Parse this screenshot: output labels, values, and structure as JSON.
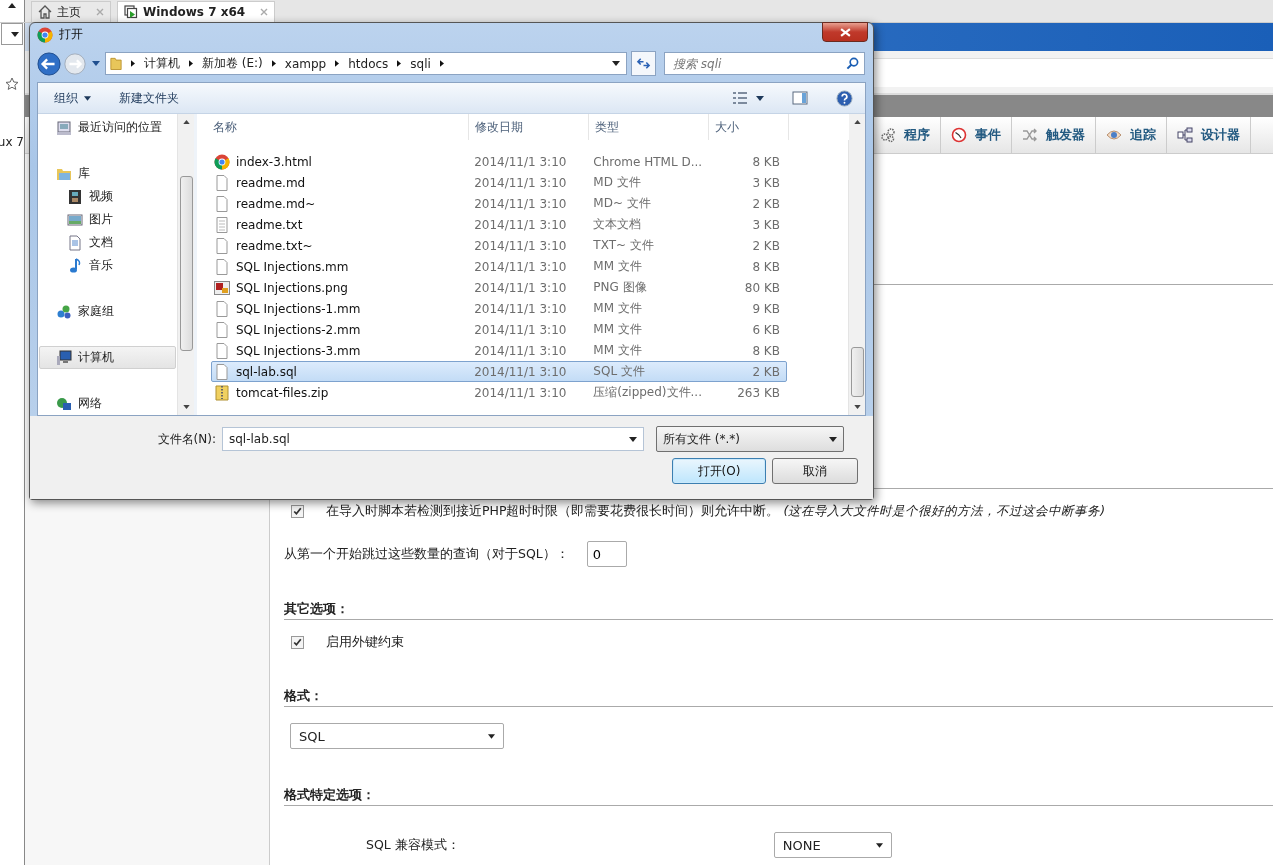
{
  "browser_tabs": [
    {
      "label": "主页",
      "selected": false
    },
    {
      "label": "Windows 7 x64",
      "selected": true
    }
  ],
  "side_strip": {
    "partial_text": "ux 7"
  },
  "page": {
    "nav_tabs": [
      {
        "label": "程序"
      },
      {
        "label": "事件"
      },
      {
        "label": "触发器"
      },
      {
        "label": "追踪"
      },
      {
        "label": "设计器"
      }
    ],
    "interrupt": {
      "checked": true,
      "text": "在导入时脚本若检测到接近PHP超时时限（即需要花费很长时间）则允许中断。",
      "note": "(这在导入大文件时是个很好的方法，不过这会中断事务)"
    },
    "skip": {
      "label": "从第一个开始跳过这些数量的查询（对于SQL）：",
      "value": "0"
    },
    "other_options": {
      "heading": "其它选项：",
      "foreign_keys": {
        "checked": true,
        "label": "启用外键约束"
      }
    },
    "format": {
      "heading": "格式：",
      "value": "SQL"
    },
    "format_options": {
      "heading": "格式特定选项：",
      "compat_label": "SQL 兼容模式：",
      "compat_value": "NONE"
    }
  },
  "dialog": {
    "title": "打开",
    "breadcrumbs": [
      "计算机",
      "新加卷 (E:)",
      "xampp",
      "htdocs",
      "sqli"
    ],
    "search": {
      "placeholder": "搜索 sqli"
    },
    "toolbar": {
      "organize": "组织",
      "new_folder": "新建文件夹"
    },
    "nav": [
      {
        "label": "最近访问的位置",
        "selected": false
      },
      {
        "label": "库",
        "selected": false,
        "children": [
          {
            "label": "视频",
            "selected": false
          },
          {
            "label": "图片",
            "selected": false
          },
          {
            "label": "文档",
            "selected": false
          },
          {
            "label": "音乐",
            "selected": false
          }
        ]
      },
      {
        "label": "家庭组",
        "selected": false
      },
      {
        "label": "计算机",
        "selected": true
      },
      {
        "label": "网络",
        "selected": false
      }
    ],
    "columns": [
      "名称",
      "修改日期",
      "类型",
      "大小"
    ],
    "files": [
      {
        "name": "index-3.html",
        "date": "2014/11/1 3:10",
        "type": "Chrome HTML D...",
        "size": "8 KB",
        "kind": "chrome",
        "selected": false
      },
      {
        "name": "readme.md",
        "date": "2014/11/1 3:10",
        "type": "MD 文件",
        "size": "3 KB",
        "kind": "blank",
        "selected": false
      },
      {
        "name": "readme.md~",
        "date": "2014/11/1 3:10",
        "type": "MD~ 文件",
        "size": "2 KB",
        "kind": "blank",
        "selected": false
      },
      {
        "name": "readme.txt",
        "date": "2014/11/1 3:10",
        "type": "文本文档",
        "size": "3 KB",
        "kind": "text",
        "selected": false
      },
      {
        "name": "readme.txt~",
        "date": "2014/11/1 3:10",
        "type": "TXT~ 文件",
        "size": "2 KB",
        "kind": "blank",
        "selected": false
      },
      {
        "name": "SQL Injections.mm",
        "date": "2014/11/1 3:10",
        "type": "MM 文件",
        "size": "8 KB",
        "kind": "blank",
        "selected": false
      },
      {
        "name": "SQL Injections.png",
        "date": "2014/11/1 3:10",
        "type": "PNG 图像",
        "size": "80 KB",
        "kind": "image",
        "selected": false
      },
      {
        "name": "SQL Injections-1.mm",
        "date": "2014/11/1 3:10",
        "type": "MM 文件",
        "size": "9 KB",
        "kind": "blank",
        "selected": false
      },
      {
        "name": "SQL Injections-2.mm",
        "date": "2014/11/1 3:10",
        "type": "MM 文件",
        "size": "6 KB",
        "kind": "blank",
        "selected": false
      },
      {
        "name": "SQL Injections-3.mm",
        "date": "2014/11/1 3:10",
        "type": "MM 文件",
        "size": "8 KB",
        "kind": "blank",
        "selected": false
      },
      {
        "name": "sql-lab.sql",
        "date": "2014/11/1 3:10",
        "type": "SQL 文件",
        "size": "2 KB",
        "kind": "blank",
        "selected": true
      },
      {
        "name": "tomcat-files.zip",
        "date": "2014/11/1 3:10",
        "type": "压缩(zipped)文件...",
        "size": "263 KB",
        "kind": "zip",
        "selected": false
      }
    ],
    "filename_label": "文件名(N):",
    "filename": "sql-lab.sql",
    "filter": "所有文件 (*.*)",
    "buttons": [
      {
        "label": "打开(O)",
        "default": true
      },
      {
        "label": "取消",
        "default": false
      }
    ]
  }
}
